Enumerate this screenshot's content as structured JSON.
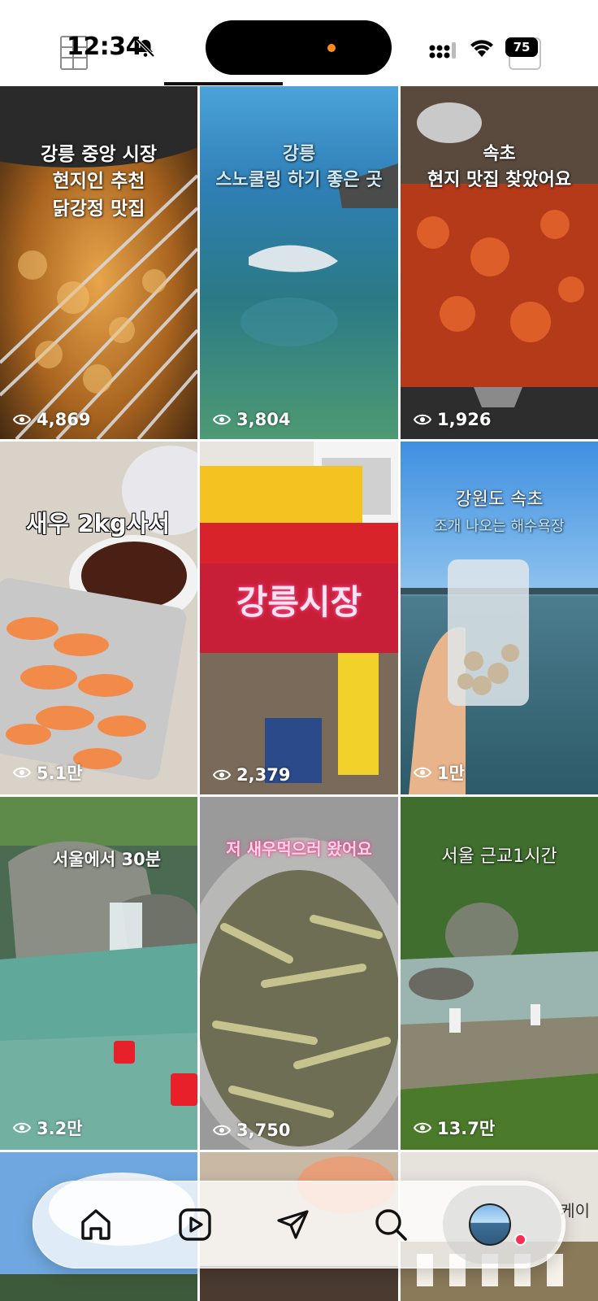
{
  "status_bar": {
    "time": "12:34",
    "battery": "75"
  },
  "grid": {
    "tiles": [
      {
        "caption": "강릉 중앙 시장\n현지인 추천\n닭강정 맛집",
        "views": "4,869"
      },
      {
        "caption": "강릉\n스노쿨링 하기 좋은 곳",
        "views": "3,804"
      },
      {
        "caption": "속초\n현지 맛집 찾았어요",
        "views": "1,926"
      },
      {
        "caption": "새우 2kg사서",
        "views": "5.1만"
      },
      {
        "caption": "강릉시장",
        "views": "2,379"
      },
      {
        "caption": "강원도 속초",
        "caption2": "조개 나오는 해수욕장",
        "views": "1만"
      },
      {
        "caption": "서울에서 30분",
        "views": "3.2만"
      },
      {
        "caption": "저 새우먹으러 왔어요",
        "views": "3,750"
      },
      {
        "caption": "서울 근교1시간",
        "views": "13.7만"
      },
      {
        "caption": ""
      },
      {
        "caption": ""
      },
      {
        "caption": "케이"
      }
    ]
  },
  "icons": {
    "home": "home-icon",
    "reels": "reels-icon",
    "direct": "send-icon",
    "search": "search-icon",
    "profile": "avatar"
  },
  "colors": {
    "notification_dot": "#ff2d55",
    "island_dot": "#ff8a1f"
  }
}
